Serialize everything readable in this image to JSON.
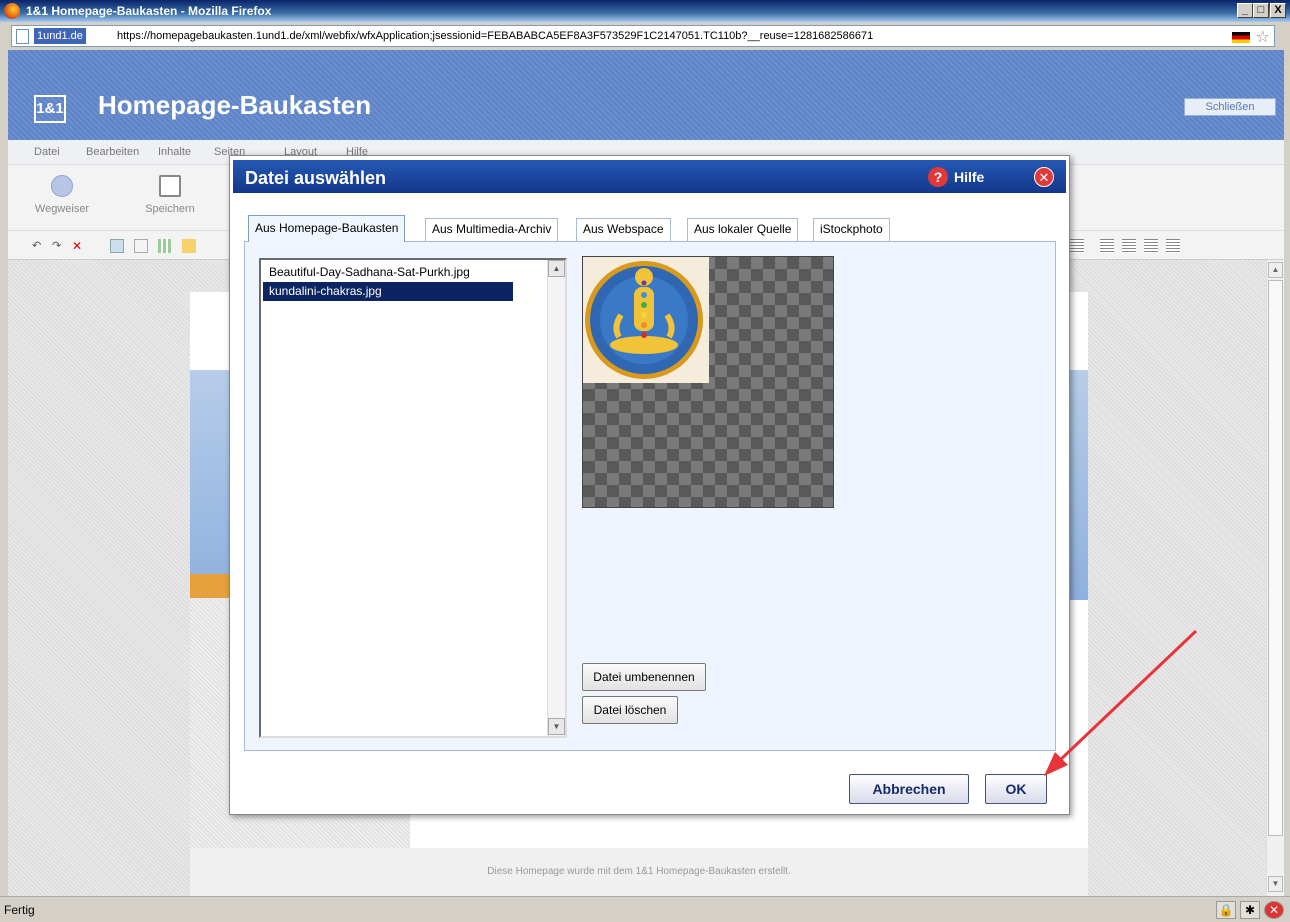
{
  "window": {
    "title": "1&1 Homepage-Baukasten - Mozilla Firefox",
    "buttons": [
      "_",
      "□",
      "X"
    ]
  },
  "urlbar": {
    "domain": "1und1.de",
    "url": "https://homepagebaukasten.1und1.de/xml/webfix/wfxApplication;jsessionid=FEBABABCA5EF8A3F573529F1C2147051.TC110b?__reuse=1281682586671"
  },
  "app": {
    "logo": "1&1",
    "title": "Homepage-Baukasten",
    "close_label": "Schließen",
    "menu": [
      "Datei",
      "Bearbeiten",
      "Inhalte",
      "Seiten",
      "Layout",
      "Hilfe"
    ],
    "toolbar": {
      "wegweiser": "Wegweiser",
      "speichern": "Speichern"
    },
    "footer_text": "Diese Homepage wurde mit dem 1&1 Homepage-Baukasten erstellt."
  },
  "dialog": {
    "title": "Datei auswählen",
    "help": "Hilfe",
    "tabs": [
      "Aus Homepage-Baukasten",
      "Aus Multimedia-Archiv",
      "Aus Webspace",
      "Aus lokaler Quelle",
      "iStockphoto"
    ],
    "active_tab": "Aus Homepage-Baukasten",
    "files": [
      {
        "name": "Beautiful-Day-Sadhana-Sat-Purkh.jpg",
        "selected": false
      },
      {
        "name": "kundalini-chakras.jpg",
        "selected": true
      }
    ],
    "rename_button": "Datei umbenennen",
    "delete_button": "Datei löschen",
    "cancel_button": "Abbrechen",
    "ok_button": "OK"
  },
  "status": {
    "text": "Fertig"
  },
  "colors": {
    "dialog_title": "#12378a",
    "selection": "#0c2461",
    "arrow": "#e8333a"
  }
}
